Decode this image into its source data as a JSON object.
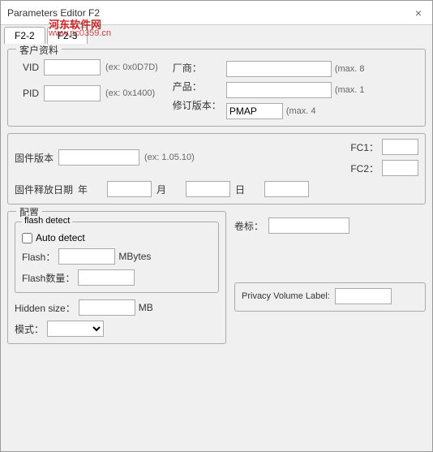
{
  "window": {
    "title": "Parameters Editor F2",
    "close_label": "×"
  },
  "watermark": {
    "line1": "河东软件网",
    "line2": "www.pc0359.cn"
  },
  "tabs": [
    {
      "id": "f2-2",
      "label": "F2-2",
      "active": false
    },
    {
      "id": "f2-3",
      "label": "F2-3",
      "active": false
    }
  ],
  "customer_group": {
    "label": "客户资料",
    "vid_label": "VID",
    "vid_hint": "(ex: 0x0D7D)",
    "pid_label": "PID",
    "pid_hint": "(ex: 0x1400)",
    "manufacturer_label": "厂商：",
    "product_label": "产品：",
    "revision_label": "修订版本：",
    "revision_value": "PMAP",
    "revision_hint": "(max. 4",
    "manufacturer_hint": "(max. 8",
    "product_hint": "(max. 1"
  },
  "firmware_group": {
    "version_label": "固件版本",
    "version_hint": "(ex: 1.05.10)",
    "date_label": "固件释放日期",
    "year_label": "年",
    "month_label": "月",
    "day_label": "日",
    "fc1_label": "FC1：",
    "fc2_label": "FC2："
  },
  "config_group": {
    "label": "配置",
    "flash_detect_label": "flash detect",
    "auto_detect_label": "Auto detect",
    "flash_label": "Flash：",
    "flash_unit": "MBytes",
    "flash_count_label": "Flash数量：",
    "hidden_size_label": "Hidden size：",
    "hidden_unit": "MB",
    "mode_label": "模式："
  },
  "right_config": {
    "volume_label": "卷标：",
    "privacy_volume_label": "Privacy Volume Label:"
  }
}
